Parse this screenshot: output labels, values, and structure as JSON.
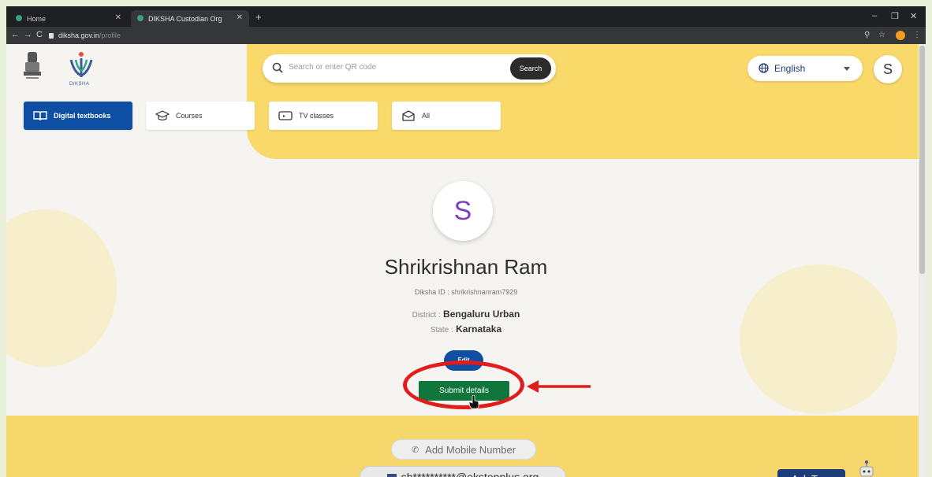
{
  "browser": {
    "tabs": [
      {
        "title": "Home",
        "active": false
      },
      {
        "title": "DIKSHA Custodian Org",
        "active": true
      }
    ],
    "url": {
      "host": "diksha.gov.in",
      "path": "/profile"
    }
  },
  "header": {
    "logo_text": "DIKSHA",
    "search": {
      "placeholder": "Search or enter QR code",
      "button": "Search"
    },
    "language": "English",
    "user_initial": "S"
  },
  "nav_tabs": [
    {
      "label": "Digital textbooks",
      "icon": "book-icon",
      "active": true
    },
    {
      "label": "Courses",
      "icon": "graduation-cap-icon",
      "active": false
    },
    {
      "label": "TV classes",
      "icon": "tv-icon",
      "active": false
    },
    {
      "label": "All",
      "icon": "inbox-icon",
      "active": false
    }
  ],
  "profile": {
    "initial": "S",
    "name": "Shrikrishnan Ram",
    "diksha_id": "Diksha ID : shrikrishnanram7929",
    "district_label": "District :",
    "district": "Bengaluru Urban",
    "state_label": "State :",
    "state": "Karnataka",
    "edit_button": "Edit",
    "submit_button": "Submit details"
  },
  "contact": {
    "add_mobile": "Add Mobile Number",
    "email": "sh**********@ekstepplus.org"
  },
  "assistant": {
    "label": "Ask Tara"
  },
  "colors": {
    "brand_yellow": "#f9d96a",
    "primary_blue": "#0e4fa3",
    "submit_green": "#11763c",
    "highlight_red": "#e21b1b"
  }
}
